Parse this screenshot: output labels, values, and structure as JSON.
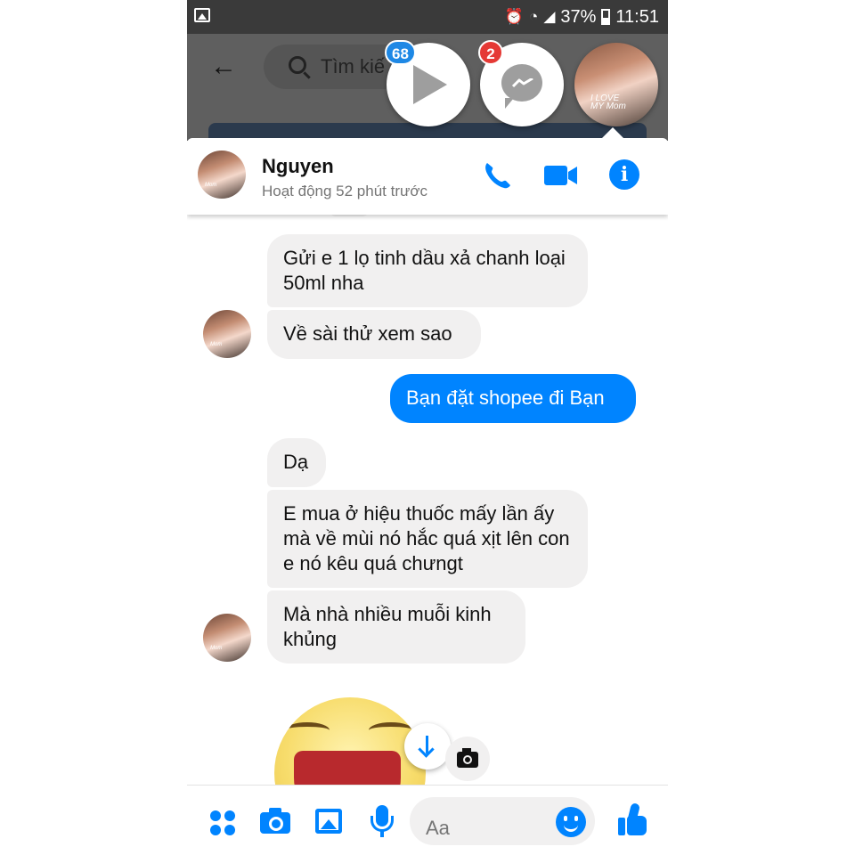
{
  "status_bar": {
    "battery": "37%",
    "time": "11:51"
  },
  "background": {
    "search_placeholder": "Tìm kiế"
  },
  "chat_heads": {
    "video_badge": "68",
    "messenger_badge": "2"
  },
  "conversation": {
    "name": "Nguyen",
    "status": "Hoạt động 52 phút trước"
  },
  "messages": [
    {
      "direction": "in",
      "text": "Gửi e 1 lọ tinh dầu xả chanh loại 50ml nha"
    },
    {
      "direction": "in",
      "text": "Về sài thử xem sao"
    },
    {
      "direction": "out",
      "text": "Bạn đặt shopee đi Bạn"
    },
    {
      "direction": "in",
      "text": "Dạ"
    },
    {
      "direction": "in",
      "text": "E mua ở hiệu thuốc mấy lần ấy mà về mùi nó hắc quá xịt lên con e nó kêu quá chưngt"
    },
    {
      "direction": "in",
      "text": "Mà nhà nhiều muỗi kinh khủng"
    }
  ],
  "composer": {
    "placeholder": "Aa"
  },
  "colors": {
    "accent": "#0084ff",
    "incoming_bubble": "#f1f0f0",
    "badge_blue": "#1e88e5",
    "badge_red": "#e53935"
  }
}
